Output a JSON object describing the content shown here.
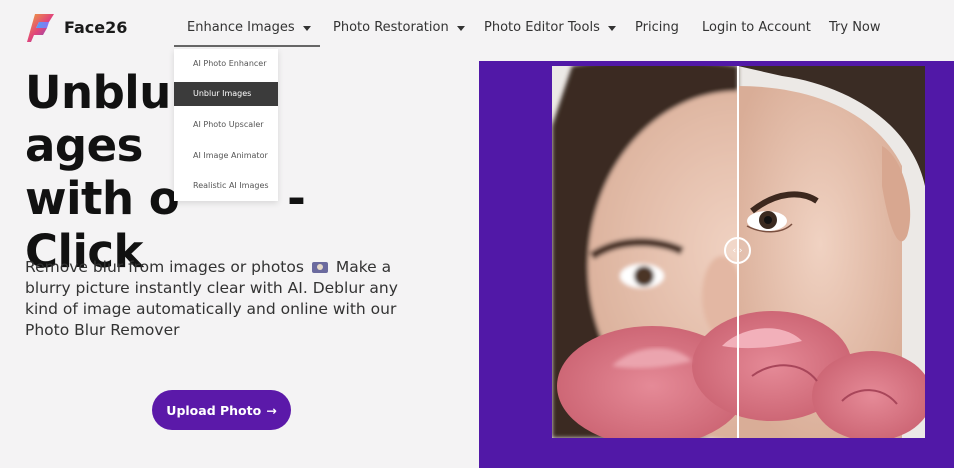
{
  "brand": {
    "name": "Face26"
  },
  "nav": {
    "items": [
      {
        "label": "Enhance Images",
        "has_caret": true
      },
      {
        "label": "Photo Restoration",
        "has_caret": true
      },
      {
        "label": "Photo Editor Tools",
        "has_caret": true
      },
      {
        "label": "Pricing",
        "has_caret": false
      },
      {
        "label": "Login to Account",
        "has_caret": false
      },
      {
        "label": "Try Now",
        "has_caret": false
      }
    ]
  },
  "dropdown": {
    "items": [
      {
        "label": "AI Photo Enhancer",
        "active": false
      },
      {
        "label": "Unblur Images",
        "active": true
      },
      {
        "label": "AI Photo Upscaler",
        "active": false
      },
      {
        "label": "AI Image Animator",
        "active": false
      },
      {
        "label": "Realistic AI Images",
        "active": false
      }
    ]
  },
  "hero": {
    "title_line1_a": "Unblur",
    "title_line1_b": "ages",
    "title_line2_a": "with o",
    "title_line2_b": "-",
    "title_line3": "Click",
    "desc_before_icon": "Remove blur from images or photos",
    "desc_after_icon": "Make a blurry picture instantly clear with AI. Deblur any kind of image automatically and online with our Photo Blur Remover",
    "upload_label": "Upload Photo",
    "upload_arrow": "→"
  },
  "compare": {
    "handle_glyph": "‹ ›"
  },
  "colors": {
    "accent": "#5b19a9",
    "panel": "#5118a7",
    "dropdown_active": "#3b3b3b",
    "background": "#f4f3f4"
  },
  "icons": {
    "logo": "face26-logo-icon",
    "camera": "camera-emoji-icon",
    "caret": "chevron-down-icon"
  }
}
